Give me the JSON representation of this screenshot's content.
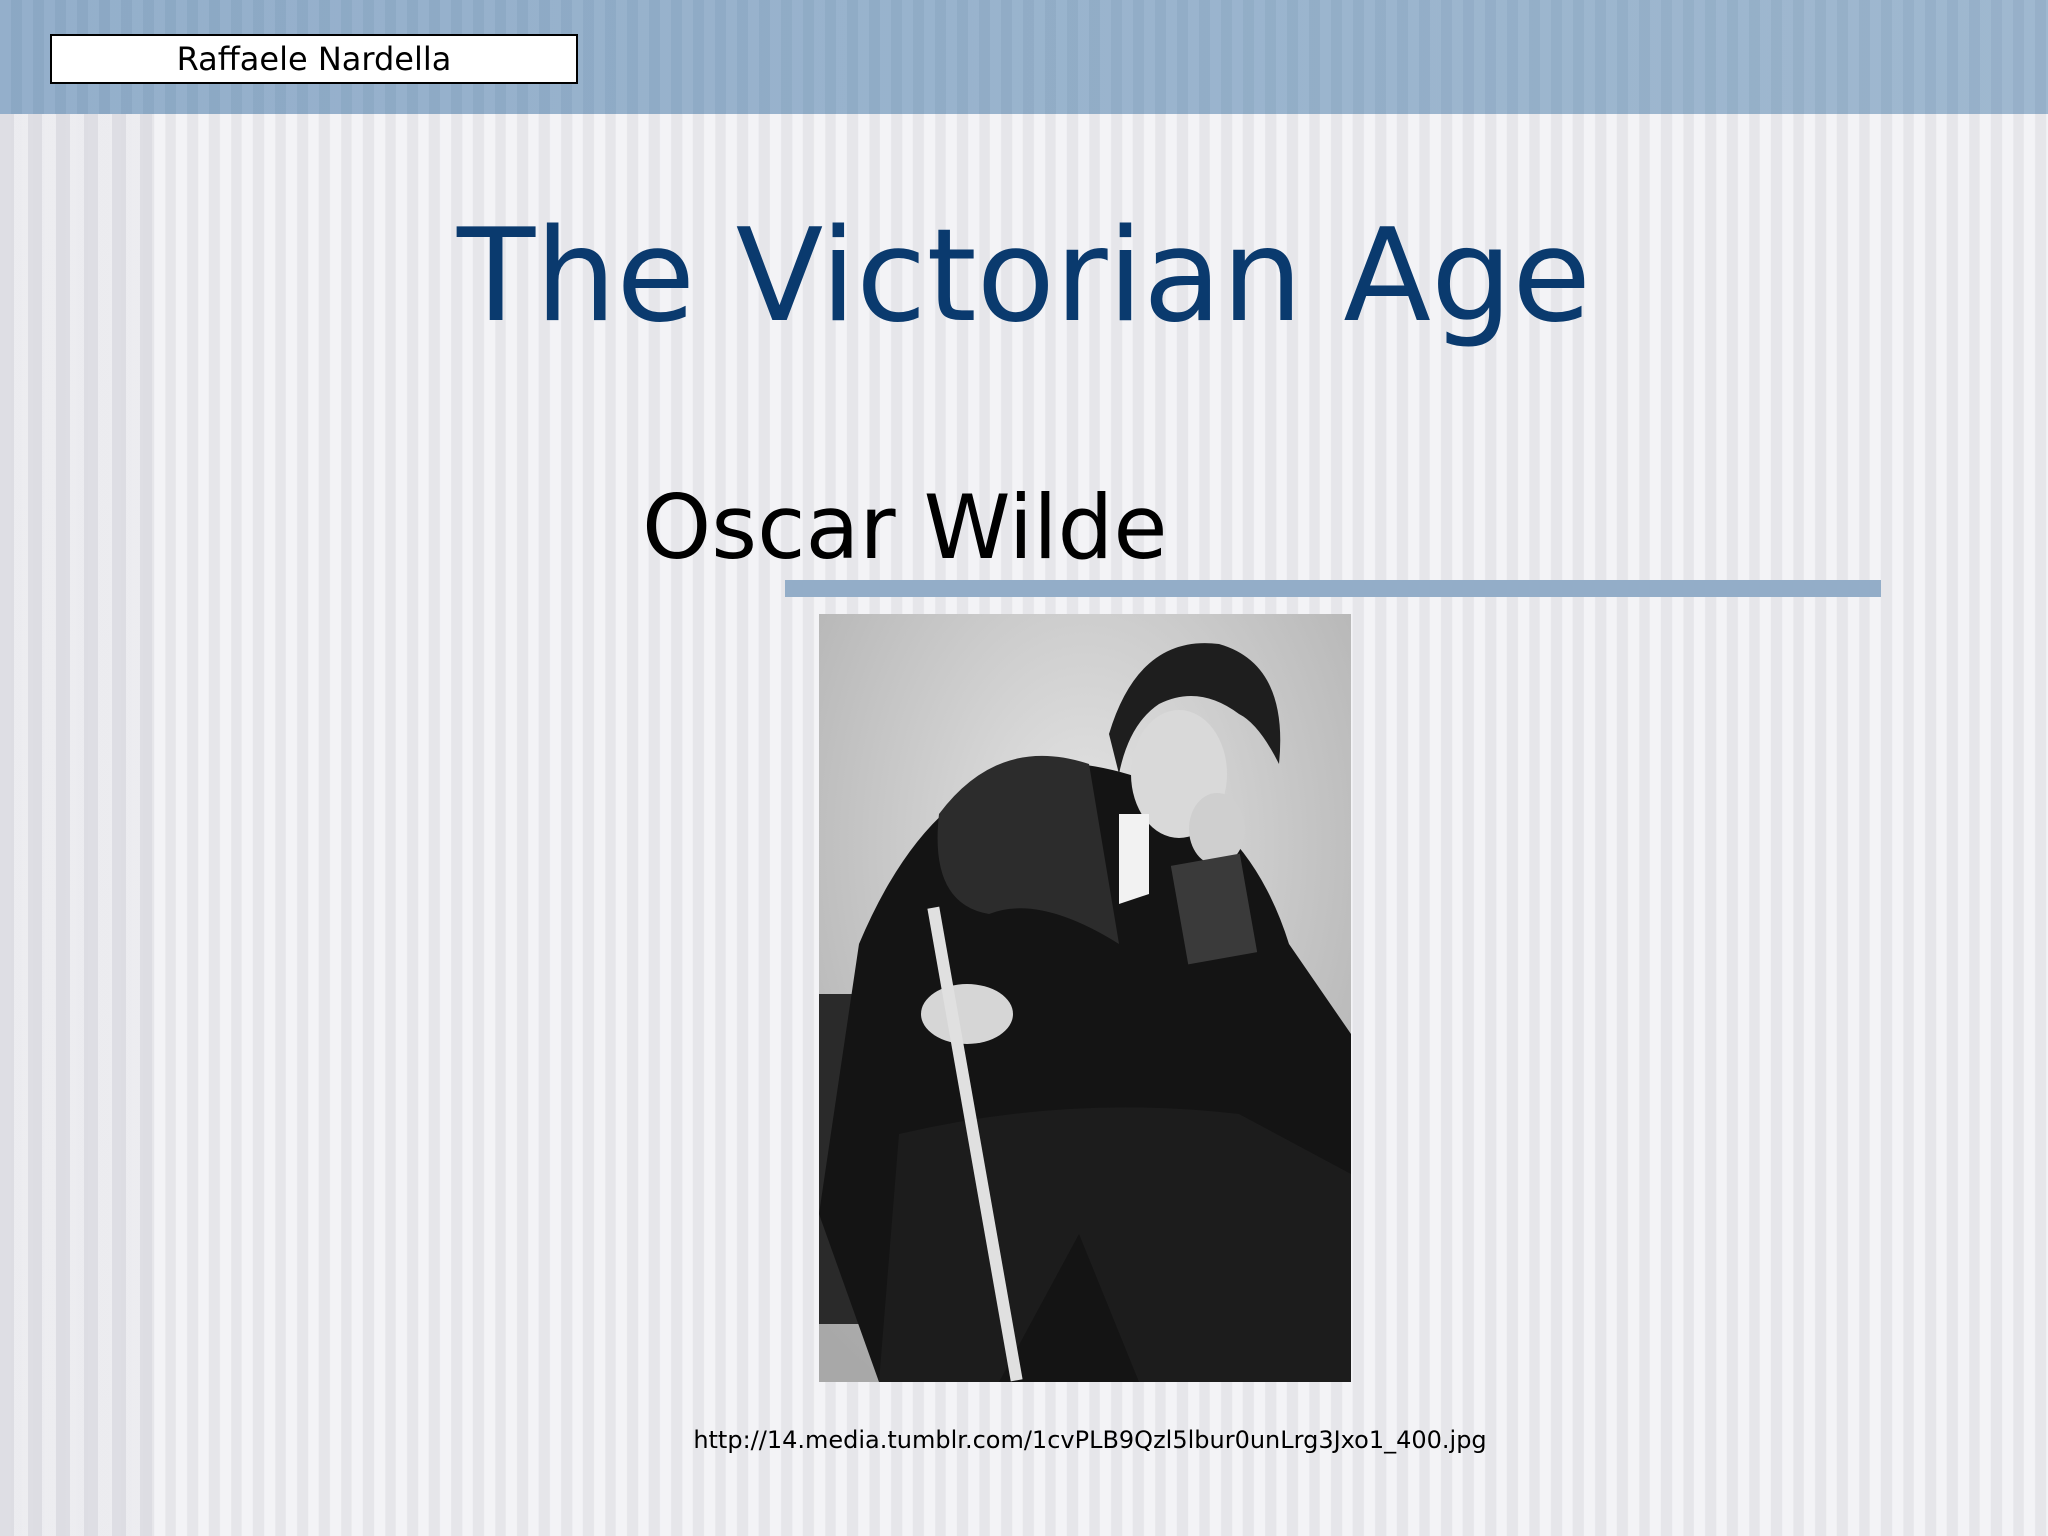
{
  "slide": {
    "author": "Raffaele Nardella",
    "title": "The Victorian Age",
    "subtitle": "Oscar Wilde",
    "image_caption": "http://14.media.tumblr.com/1cvPLB9Qzl5lbur0unLrg3Jxo1_400.jpg"
  },
  "colors": {
    "title": "#0a3a6e",
    "accent_band": "#93adc8"
  }
}
